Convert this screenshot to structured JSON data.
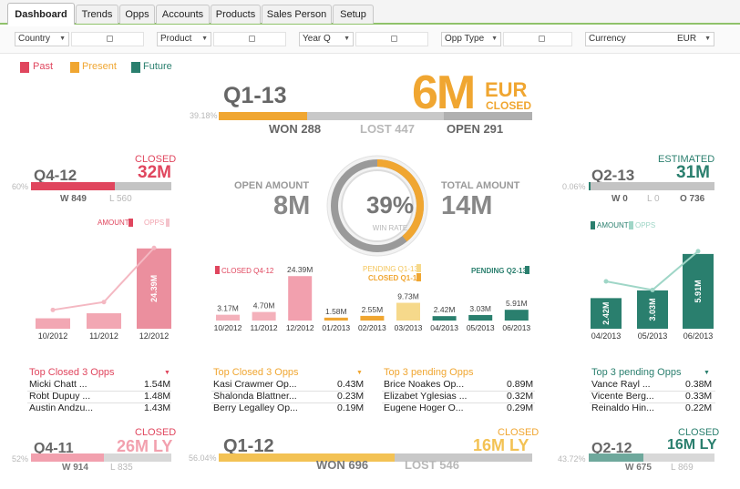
{
  "tabs": [
    "Dashboard",
    "Trends",
    "Opps",
    "Accounts",
    "Products",
    "Sales Person",
    "Setup"
  ],
  "filters": {
    "country": "Country",
    "product": "Product",
    "year": "Year Q",
    "opp_type": "Opp Type",
    "currency_label": "Currency",
    "currency_value": "EUR"
  },
  "legend": [
    {
      "label": "Past",
      "color": "#e0465e"
    },
    {
      "label": "Present",
      "color": "#f0a631"
    },
    {
      "label": "Future",
      "color": "#2a7f6e"
    }
  ],
  "colors": {
    "past": "#e0465e",
    "present": "#f0a631",
    "future": "#2a7f6e",
    "inactive": "#c4c4c4"
  },
  "header": {
    "quarter": "Q1-13",
    "pct": "39.18%",
    "amount": "6M",
    "currency": "EUR",
    "status": "CLOSED",
    "won": "WON 288",
    "lost": "LOST 447",
    "open": "OPEN 291",
    "won_fraction": 0.2807,
    "lost_fraction": 0.4357
  },
  "past_q": {
    "quarter": "Q4-12",
    "status": "CLOSED",
    "amount": "32M",
    "pct": "60%",
    "won": "W 849",
    "lost": "L 560",
    "won_fraction": 0.6
  },
  "future_q": {
    "quarter": "Q2-13",
    "status": "ESTIMATED",
    "amount": "31M",
    "pct": "0.06%",
    "won": "W 0",
    "lost": "L 0",
    "open": "O 736",
    "won_fraction": 0.0006
  },
  "center": {
    "open_label": "OPEN AMOUNT",
    "open_value": "8M",
    "total_label": "TOTAL AMOUNT",
    "total_value": "14M",
    "win_rate": "39%",
    "win_rate_label": "WIN  RATE",
    "win_rate_fraction": 0.39
  },
  "chart_data": [
    {
      "type": "bar",
      "legend": [
        "AMOUNT",
        "OPPS"
      ],
      "categories": [
        "10/2012",
        "11/2012",
        "12/2012"
      ],
      "series": [
        {
          "name": "AMOUNT",
          "values": [
            3.17,
            4.7,
            24.39
          ],
          "labels": [
            "",
            "",
            "24.39M"
          ]
        },
        {
          "name": "OPPS",
          "values": [
            120,
            170,
            515
          ]
        }
      ],
      "ylim": [
        0,
        26
      ]
    },
    {
      "type": "bar",
      "legend": [
        "CLOSED Q4-12",
        "PENDING Q1-13",
        "CLOSED Q1-13",
        "PENDING Q2-13"
      ],
      "categories": [
        "10/2012",
        "11/2012",
        "12/2012",
        "01/2013",
        "02/2013",
        "03/2013",
        "04/2013",
        "05/2013",
        "06/2013"
      ],
      "series": [
        {
          "name": "CLOSED Q4-12",
          "values": [
            3.17,
            4.7,
            24.39,
            null,
            null,
            null,
            null,
            null,
            null
          ]
        },
        {
          "name": "CLOSED Q1-13",
          "values": [
            null,
            null,
            null,
            1.58,
            2.55,
            9.73,
            null,
            null,
            null
          ]
        },
        {
          "name": "PENDING Q2-13",
          "values": [
            null,
            null,
            null,
            null,
            null,
            null,
            2.42,
            3.03,
            5.91
          ]
        }
      ],
      "labels": [
        "3.17M",
        "4.70M",
        "24.39M",
        "1.58M",
        "2.55M",
        "9.73M",
        "2.42M",
        "3.03M",
        "5.91M"
      ],
      "ylim": [
        0,
        26
      ]
    },
    {
      "type": "bar",
      "legend": [
        "AMOUNT",
        "OPPS"
      ],
      "categories": [
        "04/2013",
        "05/2013",
        "06/2013"
      ],
      "series": [
        {
          "name": "AMOUNT",
          "values": [
            2.42,
            3.03,
            5.91
          ],
          "labels": [
            "2.42M",
            "3.03M",
            "5.91M"
          ]
        },
        {
          "name": "OPPS",
          "values": [
            330,
            270,
            540
          ]
        }
      ],
      "ylim": [
        0,
        6.5
      ]
    }
  ],
  "lists": [
    {
      "title": "Top Closed 3 Opps",
      "color": "#e0465e",
      "rows": [
        [
          "Micki  Chatt ...",
          "1.54M"
        ],
        [
          "Robt  Dupuy ...",
          "1.48M"
        ],
        [
          "Austin  Andzu...",
          "1.43M"
        ]
      ]
    },
    {
      "title": "Top Closed 3 Opps",
      "color": "#f0a631",
      "rows": [
        [
          "Kasi  Crawmer Op...",
          "0.43M"
        ],
        [
          "Shalonda  Blattner...",
          "0.23M"
        ],
        [
          "Berry  Legalley Op...",
          "0.19M"
        ]
      ]
    },
    {
      "title": "Top 3 pending Opps",
      "color": "#f0a631",
      "rows": [
        [
          "Brice  Noakes Op...",
          "0.89M"
        ],
        [
          "Elizabet  Yglesias ...",
          "0.32M"
        ],
        [
          "Eugene  Hoger O...",
          "0.29M"
        ]
      ]
    },
    {
      "title": "Top 3 pending Opps",
      "color": "#2a7f6e",
      "rows": [
        [
          "Vance  Rayl ...",
          "0.38M"
        ],
        [
          "Vicente  Berg...",
          "0.33M"
        ],
        [
          "Reinaldo  Hin...",
          "0.22M"
        ]
      ]
    }
  ],
  "footer": {
    "left": {
      "quarter": "Q4-11",
      "status": "CLOSED",
      "amount": "26M LY",
      "pct": "52%",
      "won": "W 914",
      "lost": "L 835",
      "won_fraction": 0.52
    },
    "center": {
      "quarter": "Q1-12",
      "status": "CLOSED",
      "amount": "16M LY",
      "pct": "56.04%",
      "won": "WON 696",
      "lost": "LOST 546",
      "won_fraction": 0.5604
    },
    "right": {
      "quarter": "Q2-12",
      "status": "CLOSED",
      "amount": "16M LY",
      "pct": "43.72%",
      "won": "W 675",
      "lost": "L 869",
      "won_fraction": 0.4372
    }
  }
}
